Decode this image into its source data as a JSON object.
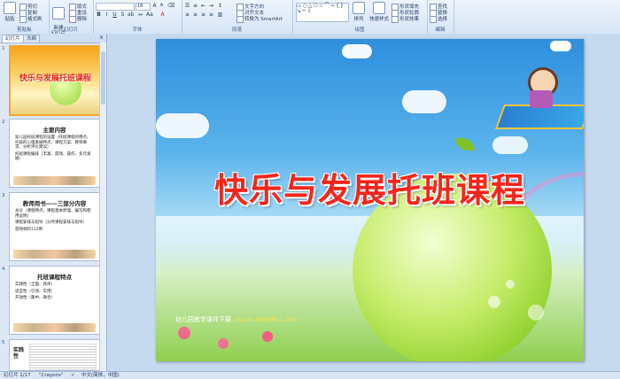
{
  "ribbon": {
    "clipboard": {
      "label": "剪贴板",
      "paste": "粘贴",
      "cut": "剪切",
      "copy": "复制",
      "format_painter": "格式刷"
    },
    "slides": {
      "label": "幻灯片",
      "new_slide": "新建\n幻灯片",
      "layout": "版式",
      "reset": "重设",
      "delete": "删除"
    },
    "font": {
      "label": "字体",
      "size": "18"
    },
    "paragraph": {
      "label": "段落",
      "text_direction": "文字方向",
      "align_text": "对齐文本",
      "smartart": "转换为 SmartArt"
    },
    "drawing": {
      "label": "绘图",
      "arrange": "排列",
      "quick_styles": "快速样式",
      "shape_fill": "形状填充",
      "shape_outline": "形状轮廓",
      "shape_effects": "形状效果"
    },
    "editing": {
      "label": "编辑",
      "find": "查找",
      "replace": "替换",
      "select": "选择"
    }
  },
  "panel": {
    "tab_slides": "幻灯片",
    "tab_outline": "大纲",
    "close": "×",
    "thumbs": [
      {
        "num": "1",
        "title": "快乐与发展托班课程"
      },
      {
        "num": "2",
        "title": "主要内容",
        "bullets": [
          "幼儿园托班课程的设置（托班课程的特点、托班的心理发展特点、课程方案、教师要求、分析评价建议）",
          "托班课程编排（丰富、游戏、操作、多元发展）"
        ]
      },
      {
        "num": "3",
        "title": "教师用书——三部分内容",
        "bullets": [
          "总论（课程特点，课程基本原理、编写和使用说明）",
          "课程安排与指导（分月课程安排与指导）",
          "游戏材料112例"
        ]
      },
      {
        "num": "4",
        "title": "托班课程特点",
        "bullets": [
          "实践性（全面、具体）",
          "适宜性（引领、实用）",
          "开放性（集中、融合）"
        ]
      },
      {
        "num": "5",
        "title": "实践性"
      }
    ]
  },
  "slide": {
    "title": "快乐与发展托班课程",
    "footer_label": "幼儿园教学课件下载",
    "footer_url": "ziyuan.baby611.com"
  },
  "status": {
    "slide_indicator": "幻灯片 1/17",
    "theme": "\"Crayons\"",
    "language": "中文(简体，中国)"
  }
}
